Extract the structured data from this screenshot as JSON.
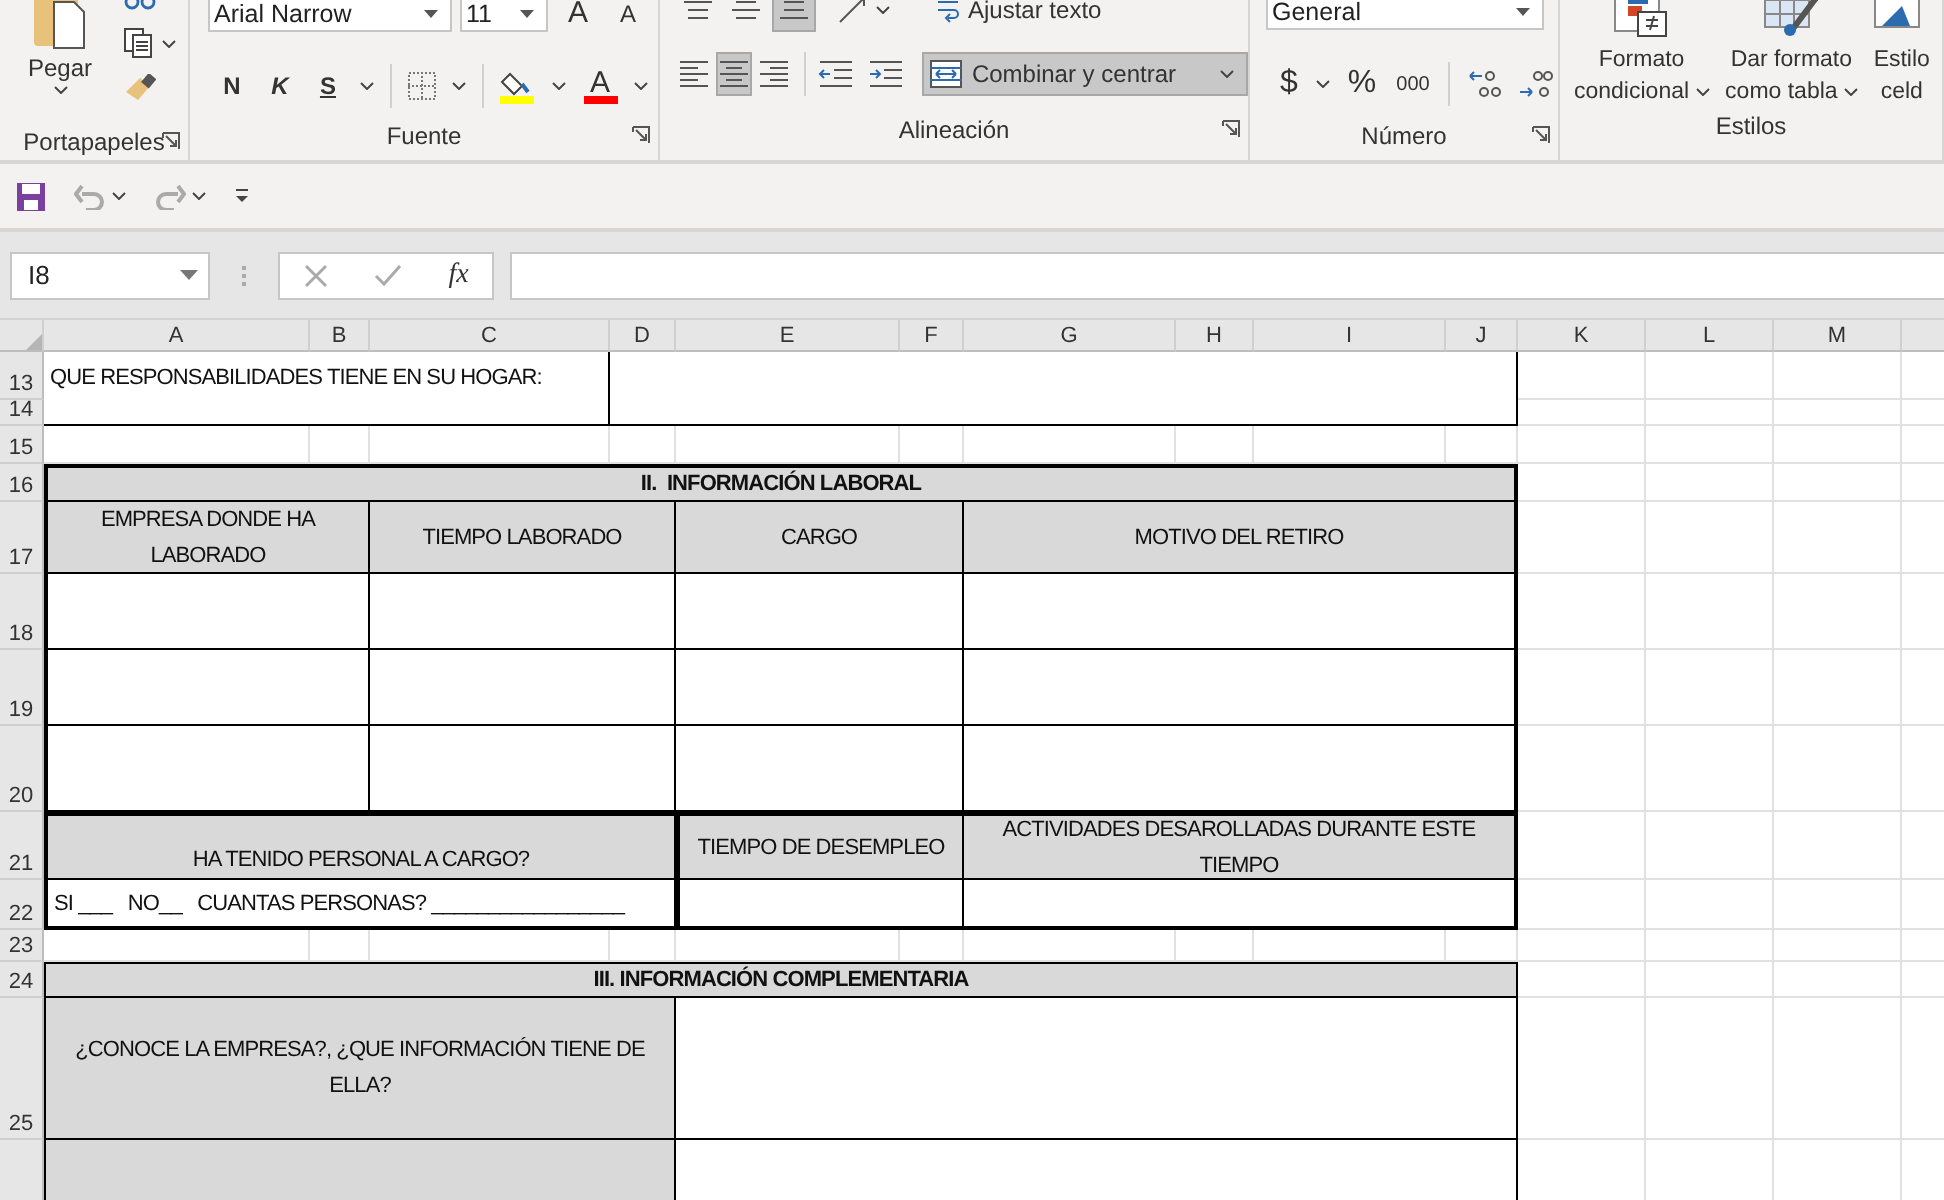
{
  "ribbon": {
    "groups": [
      {
        "kind": "clipboard",
        "label": "Portapapeles",
        "paste": "Pegar"
      },
      {
        "kind": "font",
        "label": "Fuente",
        "font": "Arial Narrow",
        "size": "11",
        "grow": "A",
        "shrink": "A",
        "bold": "N",
        "italic": "K",
        "underline": "S",
        "font_color": "A"
      },
      {
        "kind": "alignment",
        "label": "Alineación",
        "vertical_align": [
          {
            "selected": false
          },
          {
            "selected": false
          },
          {
            "selected": true
          }
        ],
        "horizontal_align": [
          {
            "selected": false
          },
          {
            "selected": true
          },
          {
            "selected": false
          }
        ],
        "wrap": "Ajustar texto",
        "merge": {
          "label": "Combinar y centrar",
          "selected": true
        }
      },
      {
        "kind": "number",
        "label": "Número",
        "format": "General",
        "currency": "$",
        "percent": "%",
        "thousands": "000"
      },
      {
        "kind": "styles",
        "label": "Estilos",
        "buttons": [
          {
            "lines": [
              "Formato",
              "condicional"
            ]
          },
          {
            "lines": [
              "Dar formato",
              "como tabla"
            ]
          },
          {
            "lines": [
              "Estilo",
              "celd"
            ]
          }
        ]
      }
    ]
  },
  "formula_bar": {
    "name_box": "I8",
    "function_label": "fx"
  },
  "sheet": {
    "columns": [
      "A",
      "B",
      "C",
      "D",
      "E",
      "F",
      "G",
      "H",
      "I",
      "J",
      "K",
      "L",
      "M"
    ],
    "rows": [
      "13",
      "14",
      "15",
      "16",
      "17",
      "18",
      "19",
      "20",
      "21",
      "22",
      "23",
      "24",
      "25"
    ],
    "cells": [
      {
        "kind": "label",
        "text": "QUE RESPONSABILIDADES TIENE EN SU HOGAR:"
      },
      {
        "kind": "blank"
      },
      {
        "kind": "section",
        "text": "II.  INFORMACIÓN LABORAL"
      },
      {
        "kind": "header",
        "text": "EMPRESA DONDE HA LABORADO"
      },
      {
        "kind": "header",
        "text": "TIEMPO LABORADO"
      },
      {
        "kind": "header",
        "text": "CARGO"
      },
      {
        "kind": "header",
        "text": "MOTIVO DEL RETIRO"
      },
      {
        "kind": "blank"
      },
      {
        "kind": "blank"
      },
      {
        "kind": "blank"
      },
      {
        "kind": "blank"
      },
      {
        "kind": "blank"
      },
      {
        "kind": "blank"
      },
      {
        "kind": "blank"
      },
      {
        "kind": "blank"
      },
      {
        "kind": "blank"
      },
      {
        "kind": "blank"
      },
      {
        "kind": "blank"
      },
      {
        "kind": "blank"
      },
      {
        "kind": "header",
        "text": "HA TENIDO PERSONAL A CARGO?"
      },
      {
        "kind": "header",
        "text": "TIEMPO DE DESEMPLEO"
      },
      {
        "kind": "header",
        "text": "ACTIVIDADES DESAROLLADAS DURANTE ESTE TIEMPO"
      },
      {
        "kind": "label",
        "text": "SI ___   NO__   CUANTAS PERSONAS? _________________"
      },
      {
        "kind": "blank"
      },
      {
        "kind": "blank"
      },
      {
        "kind": "section",
        "text": "III. INFORMACIÓN COMPLEMENTARIA"
      },
      {
        "kind": "header",
        "text": "¿CONOCE LA EMPRESA?, ¿QUE INFORMACIÓN TIENE DE ELLA?"
      },
      {
        "kind": "blank"
      },
      {
        "kind": "header"
      },
      {
        "kind": "blank"
      }
    ]
  }
}
